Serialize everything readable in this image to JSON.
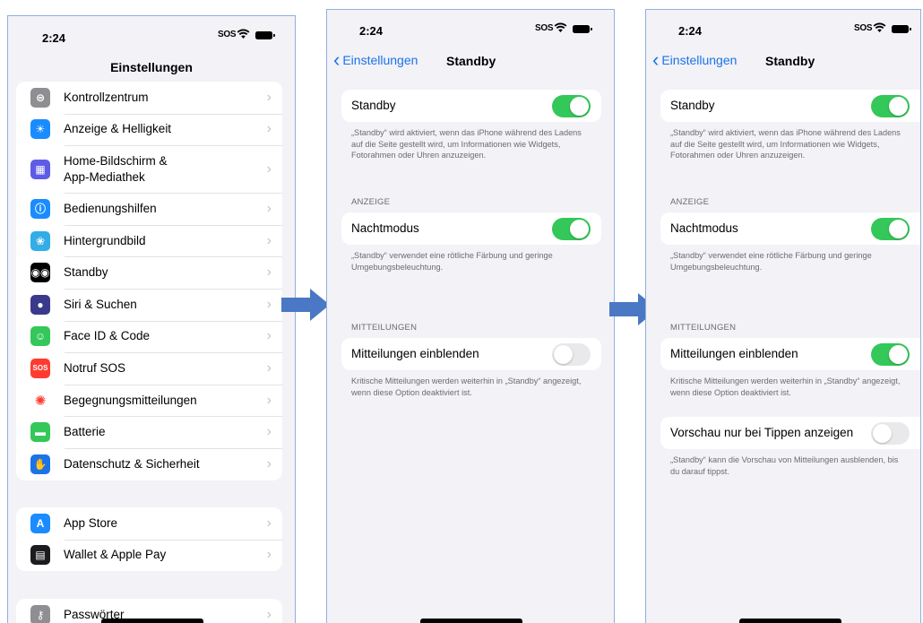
{
  "screen1": {
    "time": "2:24",
    "sos": "SOS",
    "title": "Einstellungen",
    "group1": [
      {
        "label": "Kontrollzentrum",
        "icon": "switches-icon",
        "color": "#8e8e93",
        "glyph": "⊜"
      },
      {
        "label": "Anzeige & Helligkeit",
        "icon": "sun-icon",
        "color": "#1a8cff",
        "glyph": "☀"
      },
      {
        "label": "Home-Bildschirm & App-Mediathek",
        "icon": "grid-icon",
        "color": "#5e5ce6",
        "glyph": "▦"
      },
      {
        "label": "Bedienungshilfen",
        "icon": "accessibility-icon",
        "color": "#1a8cff",
        "glyph": "ⓘ"
      },
      {
        "label": "Hintergrundbild",
        "icon": "flower-icon",
        "color": "#32ade6",
        "glyph": "❀"
      },
      {
        "label": "Standby",
        "icon": "standby-icon",
        "color": "#000000",
        "glyph": "◉◉"
      },
      {
        "label": "Siri & Suchen",
        "icon": "siri-icon",
        "color": "#3a3a8c",
        "glyph": "●"
      },
      {
        "label": "Face ID & Code",
        "icon": "faceid-icon",
        "color": "#34c759",
        "glyph": "☺"
      },
      {
        "label": "Notruf SOS",
        "icon": "sos-icon",
        "color": "#ff3b30",
        "glyph": "SOS"
      },
      {
        "label": "Begegnungsmitteilungen",
        "icon": "exposure-icon",
        "color": "#ffffff",
        "glyph": "✺"
      },
      {
        "label": "Batterie",
        "icon": "battery-icon",
        "color": "#34c759",
        "glyph": "▬"
      },
      {
        "label": "Datenschutz & Sicherheit",
        "icon": "hand-icon",
        "color": "#1a73e8",
        "glyph": "✋"
      }
    ],
    "group2": [
      {
        "label": "App Store",
        "icon": "appstore-icon",
        "color": "#1a8cff",
        "glyph": "A"
      },
      {
        "label": "Wallet & Apple Pay",
        "icon": "wallet-icon",
        "color": "#1c1c1e",
        "glyph": "▤"
      }
    ],
    "group3": [
      {
        "label": "Passwörter",
        "icon": "key-icon",
        "color": "#8e8e93",
        "glyph": "⚷"
      }
    ]
  },
  "screen2": {
    "time": "2:24",
    "sos": "SOS",
    "back": "Einstellungen",
    "title": "Standby",
    "standby_label": "Standby",
    "standby_note": "„Standby“ wird aktiviert, wenn das iPhone während des Ladens auf die Seite gestellt wird, um Informationen wie Widgets, Fotorahmen oder Uhren anzuzeigen.",
    "section_anzeige": "ANZEIGE",
    "nachtmodus_label": "Nachtmodus",
    "nachtmodus_note": "„Standby“ verwendet eine rötliche Färbung und geringe Umgebungsbeleuchtung.",
    "section_mitteilungen": "MITTEILUNGEN",
    "mitteilungen_label": "Mitteilungen einblenden",
    "mitteilungen_note": "Kritische Mitteilungen werden weiterhin in „Standby“ angezeigt, wenn diese Option deaktiviert ist.",
    "toggles": {
      "standby": true,
      "nachtmodus": true,
      "mitteilungen": false
    }
  },
  "screen3": {
    "time": "2:24",
    "sos": "SOS",
    "back": "Einstellungen",
    "title": "Standby",
    "standby_label": "Standby",
    "standby_note": "„Standby“ wird aktiviert, wenn das iPhone während des Ladens auf die Seite gestellt wird, um Informationen wie Widgets, Fotorahmen oder Uhren anzuzeigen.",
    "section_anzeige": "ANZEIGE",
    "nachtmodus_label": "Nachtmodus",
    "nachtmodus_note": "„Standby“ verwendet eine rötliche Färbung und geringe Umgebungsbeleuchtung.",
    "section_mitteilungen": "MITTEILUNGEN",
    "mitteilungen_label": "Mitteilungen einblenden",
    "mitteilungen_note": "Kritische Mitteilungen werden weiterhin in „Standby“ angezeigt, wenn diese Option deaktiviert ist.",
    "vorschau_label": "Vorschau nur bei Tippen anzeigen",
    "vorschau_note": "„Standby“ kann die Vorschau von Mitteilungen ausblenden, bis du darauf tippst.",
    "toggles": {
      "standby": true,
      "nachtmodus": true,
      "mitteilungen": true,
      "vorschau": false
    }
  },
  "colors": {
    "accent": "#1a73e8",
    "toggle_on": "#34c759",
    "arrow": "#4a78c4"
  }
}
